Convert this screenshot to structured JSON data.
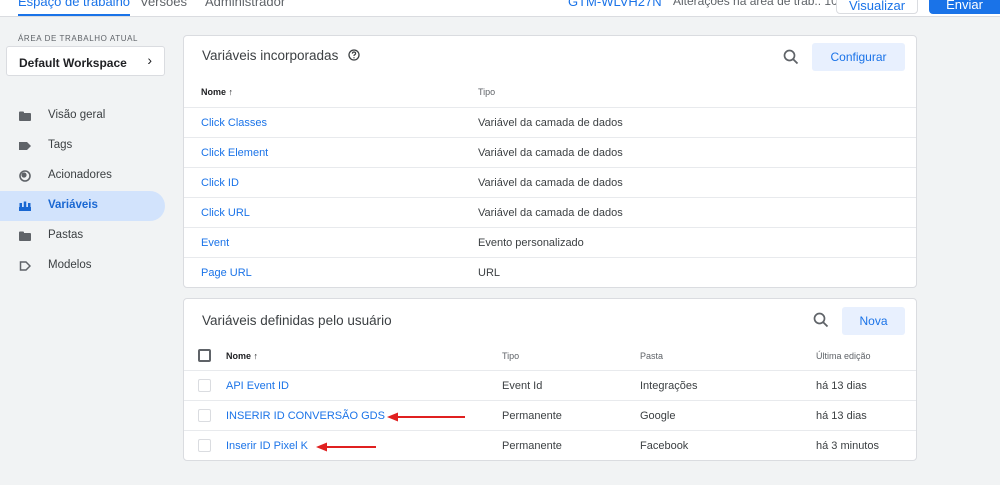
{
  "topbar": {
    "tabs": [
      {
        "label": "Espaço de trabalho",
        "active": true
      },
      {
        "label": "Versões",
        "active": false
      },
      {
        "label": "Administrador",
        "active": false
      }
    ],
    "container_id": "GTM-WLVH27N",
    "changes_text": "Alterações na área de trab.: 10",
    "preview_label": "Visualizar",
    "submit_label": "Enviar"
  },
  "sidebar": {
    "workspace_heading": "ÁREA DE TRABALHO ATUAL",
    "workspace_name": "Default Workspace",
    "items": [
      {
        "label": "Visão geral",
        "icon": "folder-icon",
        "active": false
      },
      {
        "label": "Tags",
        "icon": "tag-icon",
        "active": false
      },
      {
        "label": "Acionadores",
        "icon": "trigger-icon",
        "active": false
      },
      {
        "label": "Variáveis",
        "icon": "variables-icon",
        "active": true
      },
      {
        "label": "Pastas",
        "icon": "folder-icon",
        "active": false
      },
      {
        "label": "Modelos",
        "icon": "template-icon",
        "active": false
      }
    ]
  },
  "builtin": {
    "title": "Variáveis incorporadas",
    "configure_label": "Configurar",
    "col_name": "Nome ↑",
    "col_type": "Tipo",
    "rows": [
      {
        "name": "Click Classes",
        "type": "Variável da camada de dados"
      },
      {
        "name": "Click Element",
        "type": "Variável da camada de dados"
      },
      {
        "name": "Click ID",
        "type": "Variável da camada de dados"
      },
      {
        "name": "Click URL",
        "type": "Variável da camada de dados"
      },
      {
        "name": "Event",
        "type": "Evento personalizado"
      },
      {
        "name": "Page URL",
        "type": "URL"
      }
    ]
  },
  "userdefined": {
    "title": "Variáveis definidas pelo usuário",
    "new_label": "Nova",
    "col_name": "Nome ↑",
    "col_type": "Tipo",
    "col_folder": "Pasta",
    "col_edited": "Última edição",
    "rows": [
      {
        "name": "API Event ID",
        "type": "Event Id",
        "folder": "Integrações",
        "edited": "há 13 dias"
      },
      {
        "name": "INSERIR ID CONVERSÃO GDS",
        "type": "Permanente",
        "folder": "Google",
        "edited": "há 13 dias"
      },
      {
        "name": "Inserir ID Pixel K",
        "type": "Permanente",
        "folder": "Facebook",
        "edited": "há 3 minutos"
      }
    ]
  },
  "colors": {
    "accent": "#1a73e8",
    "annotation_arrow": "#e02020"
  }
}
